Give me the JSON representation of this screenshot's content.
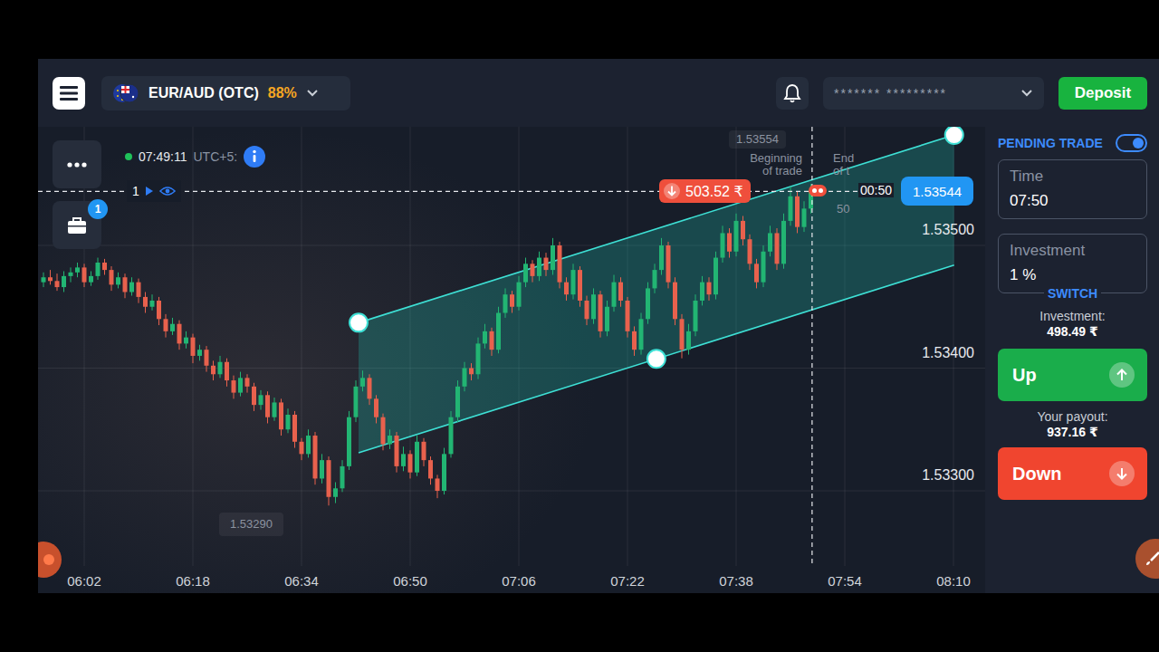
{
  "header": {
    "asset_name": "EUR/AUD (OTC)",
    "payout": "88%",
    "account": "******* *********",
    "deposit_button": "Deposit"
  },
  "chart": {
    "clock": "07:49:11",
    "timezone": "UTC+5:",
    "open_positions_badge": "1",
    "trade_line_label": "1",
    "trade": {
      "amount": "503.52 ₹",
      "direction": "down"
    },
    "countdown": "00:50",
    "current_price": "1.53544",
    "begin_label": [
      "Beginning",
      "of trade"
    ],
    "end_label": [
      "End",
      "of t",
      "50"
    ],
    "hover_price": "1.53554",
    "low_price": "1.53290",
    "y_ticks": [
      "1.53500",
      "1.53400",
      "1.53300"
    ],
    "x_ticks": [
      "06:02",
      "06:18",
      "06:34",
      "06:50",
      "07:06",
      "07:22",
      "07:38",
      "07:54",
      "08:10"
    ],
    "channel": {
      "upper": [
        1.53437,
        1.5359
      ],
      "lower": [
        1.53331,
        1.53484
      ]
    },
    "candles": [
      [
        1.5347,
        1.53478,
        1.53466,
        1.53474
      ],
      [
        1.53474,
        1.5348,
        1.53468,
        1.53471
      ],
      [
        1.53471,
        1.53477,
        1.53463,
        1.53466
      ],
      [
        1.53466,
        1.53479,
        1.53462,
        1.53475
      ],
      [
        1.53475,
        1.53482,
        1.5347,
        1.53478
      ],
      [
        1.53478,
        1.53486,
        1.53474,
        1.53482
      ],
      [
        1.53482,
        1.53485,
        1.53466,
        1.5347
      ],
      [
        1.5347,
        1.53479,
        1.53467,
        1.53475
      ],
      [
        1.53475,
        1.5349,
        1.53472,
        1.53486
      ],
      [
        1.53486,
        1.53489,
        1.53476,
        1.5348
      ],
      [
        1.5348,
        1.53483,
        1.53463,
        1.53468
      ],
      [
        1.53468,
        1.53478,
        1.53465,
        1.53474
      ],
      [
        1.53474,
        1.53477,
        1.53457,
        1.53462
      ],
      [
        1.53462,
        1.53474,
        1.53459,
        1.5347
      ],
      [
        1.5347,
        1.53473,
        1.53453,
        1.53458
      ],
      [
        1.53458,
        1.53462,
        1.53445,
        1.5345
      ],
      [
        1.5345,
        1.5346,
        1.53447,
        1.53455
      ],
      [
        1.53455,
        1.53458,
        1.53435,
        1.5344
      ],
      [
        1.5344,
        1.53444,
        1.53425,
        1.5343
      ],
      [
        1.5343,
        1.53441,
        1.53427,
        1.53436
      ],
      [
        1.53436,
        1.53439,
        1.53415,
        1.5342
      ],
      [
        1.5342,
        1.5343,
        1.53416,
        1.53425
      ],
      [
        1.53425,
        1.53428,
        1.53404,
        1.5341
      ],
      [
        1.5341,
        1.53419,
        1.53406,
        1.53415
      ],
      [
        1.53415,
        1.53418,
        1.53397,
        1.53402
      ],
      [
        1.53402,
        1.53406,
        1.5339,
        1.53395
      ],
      [
        1.53395,
        1.5341,
        1.53392,
        1.53405
      ],
      [
        1.53405,
        1.53408,
        1.53385,
        1.5339
      ],
      [
        1.5339,
        1.53394,
        1.53375,
        1.5338
      ],
      [
        1.5338,
        1.53397,
        1.53377,
        1.53392
      ],
      [
        1.53392,
        1.53395,
        1.5338,
        1.53385
      ],
      [
        1.53385,
        1.53388,
        1.53365,
        1.5337
      ],
      [
        1.5337,
        1.53382,
        1.53366,
        1.53378
      ],
      [
        1.53378,
        1.53381,
        1.53355,
        1.5336
      ],
      [
        1.5336,
        1.53376,
        1.53357,
        1.53372
      ],
      [
        1.53372,
        1.53375,
        1.53345,
        1.5335
      ],
      [
        1.5335,
        1.53367,
        1.53347,
        1.53362
      ],
      [
        1.53362,
        1.53365,
        1.53335,
        1.5334
      ],
      [
        1.5334,
        1.53343,
        1.53325,
        1.5333
      ],
      [
        1.5333,
        1.5335,
        1.53327,
        1.53345
      ],
      [
        1.53345,
        1.53348,
        1.53305,
        1.5331
      ],
      [
        1.5331,
        1.5333,
        1.53306,
        1.53325
      ],
      [
        1.53325,
        1.53328,
        1.53288,
        1.53295
      ],
      [
        1.53295,
        1.53307,
        1.5329,
        1.53302
      ],
      [
        1.53302,
        1.53325,
        1.53299,
        1.5332
      ],
      [
        1.5332,
        1.53365,
        1.53317,
        1.5336
      ],
      [
        1.5336,
        1.5339,
        1.53356,
        1.53385
      ],
      [
        1.53385,
        1.53398,
        1.53381,
        1.53392
      ],
      [
        1.53392,
        1.53395,
        1.5337,
        1.53375
      ],
      [
        1.53375,
        1.53378,
        1.53355,
        1.5336
      ],
      [
        1.5336,
        1.53363,
        1.53333,
        1.53338
      ],
      [
        1.53338,
        1.5335,
        1.53334,
        1.53345
      ],
      [
        1.53345,
        1.53348,
        1.53315,
        1.5332
      ],
      [
        1.5332,
        1.53336,
        1.53316,
        1.5333
      ],
      [
        1.5333,
        1.53333,
        1.5331,
        1.53315
      ],
      [
        1.53315,
        1.53345,
        1.53312,
        1.5334
      ],
      [
        1.5334,
        1.53343,
        1.5332,
        1.53325
      ],
      [
        1.53325,
        1.53328,
        1.53305,
        1.5331
      ],
      [
        1.5331,
        1.53313,
        1.53294,
        1.533
      ],
      [
        1.533,
        1.53335,
        1.53297,
        1.5333
      ],
      [
        1.5333,
        1.53365,
        1.53327,
        1.5336
      ],
      [
        1.5336,
        1.5339,
        1.53356,
        1.53385
      ],
      [
        1.53385,
        1.53405,
        1.53381,
        1.534
      ],
      [
        1.534,
        1.53404,
        1.5339,
        1.53395
      ],
      [
        1.53395,
        1.53425,
        1.53391,
        1.5342
      ],
      [
        1.5342,
        1.53436,
        1.53416,
        1.5343
      ],
      [
        1.5343,
        1.53433,
        1.5341,
        1.53415
      ],
      [
        1.53415,
        1.5345,
        1.53412,
        1.53445
      ],
      [
        1.53445,
        1.53465,
        1.53441,
        1.5346
      ],
      [
        1.5346,
        1.53463,
        1.53445,
        1.5345
      ],
      [
        1.5345,
        1.53475,
        1.53447,
        1.5347
      ],
      [
        1.5347,
        1.5349,
        1.53466,
        1.53485
      ],
      [
        1.53485,
        1.53488,
        1.5347,
        1.53475
      ],
      [
        1.53475,
        1.53495,
        1.53471,
        1.5349
      ],
      [
        1.5349,
        1.53494,
        1.53475,
        1.5348
      ],
      [
        1.5348,
        1.53506,
        1.53476,
        1.535
      ],
      [
        1.535,
        1.53503,
        1.53465,
        1.5347
      ],
      [
        1.5347,
        1.53474,
        1.53455,
        1.5346
      ],
      [
        1.5346,
        1.53485,
        1.53456,
        1.5348
      ],
      [
        1.5348,
        1.53483,
        1.5345,
        1.53455
      ],
      [
        1.53455,
        1.53459,
        1.53435,
        1.5344
      ],
      [
        1.5344,
        1.53465,
        1.53436,
        1.5346
      ],
      [
        1.5346,
        1.53463,
        1.53425,
        1.5343
      ],
      [
        1.5343,
        1.53455,
        1.53426,
        1.5345
      ],
      [
        1.5345,
        1.53476,
        1.53446,
        1.5347
      ],
      [
        1.5347,
        1.53474,
        1.5345,
        1.53455
      ],
      [
        1.53455,
        1.53458,
        1.53425,
        1.5343
      ],
      [
        1.5343,
        1.53434,
        1.5341,
        1.53415
      ],
      [
        1.53415,
        1.53445,
        1.53411,
        1.5344
      ],
      [
        1.5344,
        1.5347,
        1.53436,
        1.53465
      ],
      [
        1.53465,
        1.53485,
        1.53461,
        1.5348
      ],
      [
        1.5348,
        1.53506,
        1.53476,
        1.535
      ],
      [
        1.535,
        1.53503,
        1.53465,
        1.5347
      ],
      [
        1.5347,
        1.53474,
        1.53435,
        1.5344
      ],
      [
        1.5344,
        1.53444,
        1.53408,
        1.53415
      ],
      [
        1.53415,
        1.53436,
        1.53411,
        1.5343
      ],
      [
        1.5343,
        1.5346,
        1.53426,
        1.53455
      ],
      [
        1.53455,
        1.53475,
        1.53451,
        1.5347
      ],
      [
        1.5347,
        1.53474,
        1.53455,
        1.5346
      ],
      [
        1.5346,
        1.53495,
        1.53456,
        1.5349
      ],
      [
        1.5349,
        1.53516,
        1.53486,
        1.5351
      ],
      [
        1.5351,
        1.53514,
        1.5349,
        1.53495
      ],
      [
        1.53495,
        1.53526,
        1.53491,
        1.5352
      ],
      [
        1.5352,
        1.53524,
        1.535,
        1.53505
      ],
      [
        1.53505,
        1.53509,
        1.5348,
        1.53485
      ],
      [
        1.53485,
        1.53489,
        1.53465,
        1.5347
      ],
      [
        1.5347,
        1.535,
        1.53466,
        1.53495
      ],
      [
        1.53495,
        1.53516,
        1.53491,
        1.5351
      ],
      [
        1.5351,
        1.53514,
        1.5348,
        1.53485
      ],
      [
        1.53485,
        1.53526,
        1.53481,
        1.5352
      ],
      [
        1.5352,
        1.53548,
        1.53516,
        1.5354
      ],
      [
        1.5354,
        1.53544,
        1.5351,
        1.53515
      ],
      [
        1.53515,
        1.53536,
        1.53511,
        1.5353
      ],
      [
        1.5353,
        1.5355,
        1.53526,
        1.53544
      ]
    ]
  },
  "panel": {
    "pending_trade": {
      "label": "PENDING TRADE",
      "on": true
    },
    "time": {
      "label": "Time",
      "value": "07:50"
    },
    "investment": {
      "label": "Investment",
      "value": "1 %",
      "switch": "SWITCH"
    },
    "investment_summary": {
      "label": "Investment:",
      "value": "498.49 ₹"
    },
    "up_button": "Up",
    "payout": {
      "label": "Your payout:",
      "value": "937.16 ₹"
    },
    "down_button": "Down"
  }
}
